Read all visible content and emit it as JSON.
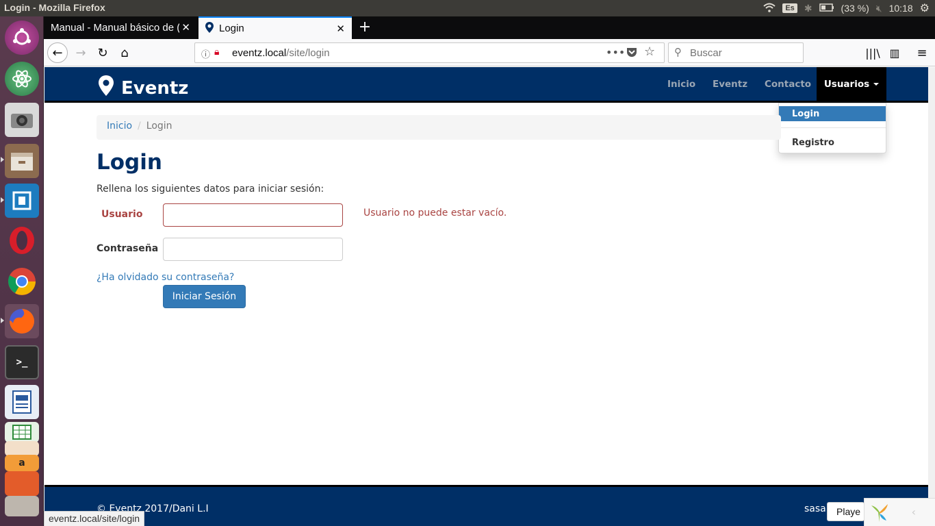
{
  "panel": {
    "window_title": "Login - Mozilla Firefox",
    "keyboard_layout": "Es",
    "battery": "(33 %)",
    "clock": "10:18"
  },
  "launcher": {
    "apps": [
      "ubuntu-dash-icon",
      "atom-icon",
      "camera-icon",
      "files-icon",
      "brackets-icon",
      "opera-icon",
      "chrome-icon",
      "firefox-icon",
      "terminal-icon",
      "writer-icon",
      "calc-icon",
      "impress-icon",
      "amazon-icon",
      "software-icon"
    ]
  },
  "browser": {
    "tabs": [
      {
        "label": "Manual - Manual básico de ("
      },
      {
        "label": "Login"
      }
    ],
    "url_host": "eventz.local",
    "url_path": "/site/login",
    "search_placeholder": "Buscar"
  },
  "site": {
    "brand": "Eventz",
    "nav": {
      "inicio": "Inicio",
      "eventz": "Eventz",
      "contacto": "Contacto",
      "usuarios": "Usuarios"
    },
    "dropdown": {
      "login": "Login",
      "registro": "Registro"
    },
    "breadcrumb": {
      "home": "Inicio",
      "separator": "/",
      "current": "Login"
    },
    "page_title": "Login",
    "intro": "Rellena los siguientes datos para iniciar sesión:",
    "form": {
      "user_label": "Usuario",
      "user_value": "",
      "user_error": "Usuario no puede estar vacío.",
      "pass_label": "Contraseña",
      "pass_value": "",
      "forgot_link": "¿Ha olvidado su contraseña?",
      "submit": "Iniciar Sesión"
    },
    "footer": {
      "copyright": "© Eventz 2017/Dani L.I",
      "right_text": "sasa"
    }
  },
  "status_link": "eventz.local/site/login",
  "debug_tooltip": "Playe",
  "colors": {
    "header_bg": "#002f66",
    "error": "#a94442",
    "link": "#337ab7",
    "button": "#337ab7"
  }
}
